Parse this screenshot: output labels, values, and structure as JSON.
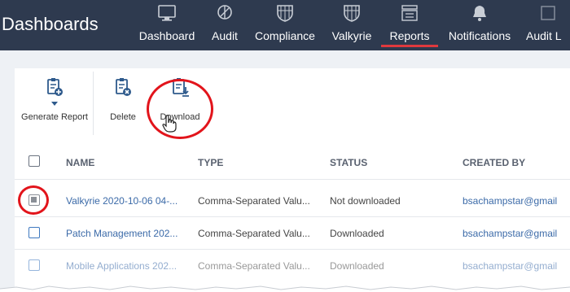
{
  "app": {
    "title": "Dashboards"
  },
  "nav": {
    "items": [
      {
        "label": "Dashboard",
        "icon": "monitor-icon"
      },
      {
        "label": "Audit",
        "icon": "audit-icon"
      },
      {
        "label": "Compliance",
        "icon": "compliance-icon"
      },
      {
        "label": "Valkyrie",
        "icon": "valkyrie-icon"
      },
      {
        "label": "Reports",
        "icon": "reports-icon",
        "active": true
      },
      {
        "label": "Notifications",
        "icon": "bell-icon"
      },
      {
        "label": "Audit L",
        "icon": "audit-log-icon"
      }
    ]
  },
  "toolbar": {
    "generate_label": "Generate Report",
    "delete_label": "Delete",
    "download_label": "Download"
  },
  "table": {
    "columns": [
      "NAME",
      "TYPE",
      "STATUS",
      "CREATED BY"
    ],
    "rows": [
      {
        "name": "Valkyrie 2020-10-06 04-...",
        "type": "Comma-Separated Valu...",
        "status": "Not downloaded",
        "created_by": "bsachampstar@gmail",
        "checked": true
      },
      {
        "name": "Patch Management 202...",
        "type": "Comma-Separated Valu...",
        "status": "Downloaded",
        "created_by": "bsachampstar@gmail",
        "checked": false
      },
      {
        "name": "Mobile Applications 202...",
        "type": "Comma-Separated Valu...",
        "status": "Downloaded",
        "created_by": "bsachampstar@gmail",
        "checked": false
      }
    ]
  },
  "colors": {
    "topbar": "#2e3a4f",
    "accent": "#e0393e",
    "link": "#3b6aa8",
    "highlight": "#e2141b"
  }
}
